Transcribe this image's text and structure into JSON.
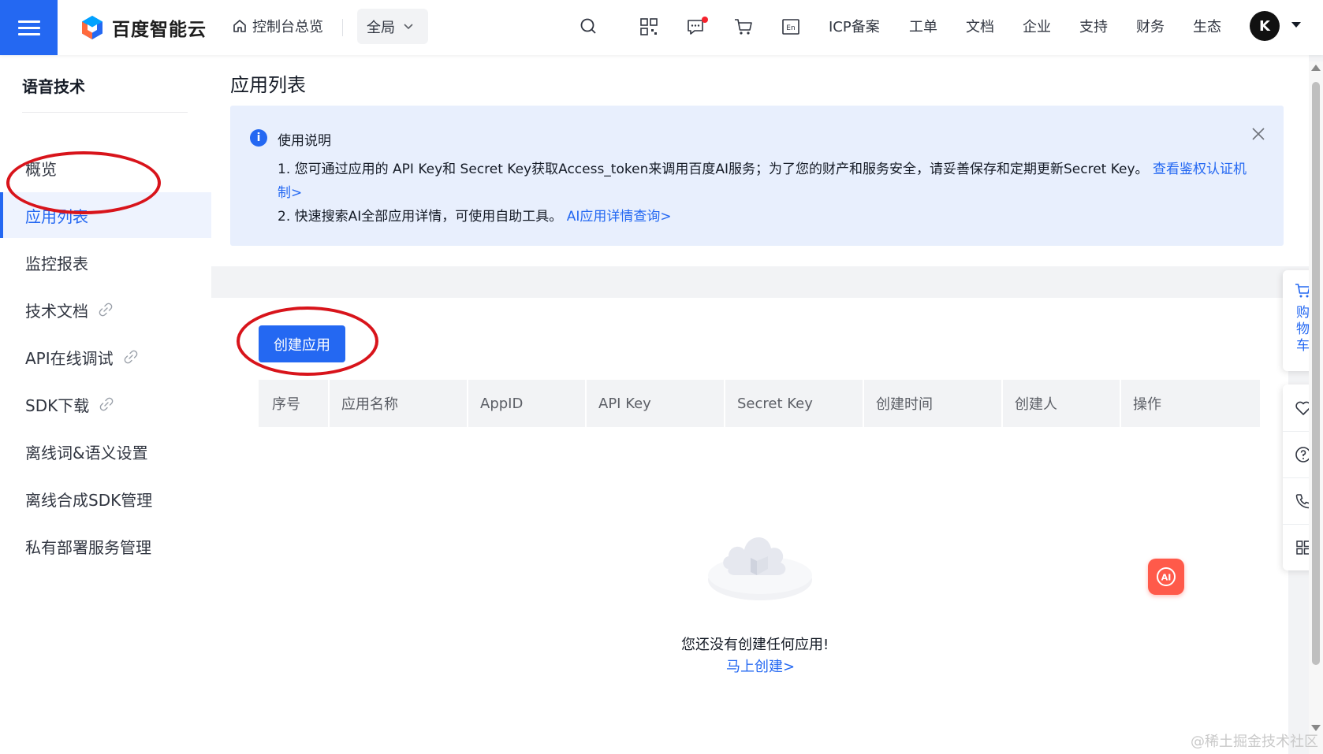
{
  "topbar": {
    "brand": "百度智能云",
    "home_label": "控制台总览",
    "region_label": "全局",
    "icons": [
      "search-icon",
      "qrcode-icon",
      "message-icon",
      "cart-icon",
      "language-icon"
    ],
    "nav": [
      "ICP备案",
      "工单",
      "文档",
      "企业",
      "支持",
      "财务",
      "生态"
    ],
    "avatar_letter": "K",
    "accent": "#2468f2"
  },
  "sidebar": {
    "title": "语音技术",
    "items": [
      {
        "label": "概览",
        "link": false
      },
      {
        "label": "应用列表",
        "link": false,
        "active": true
      },
      {
        "label": "监控报表",
        "link": false
      },
      {
        "label": "技术文档",
        "link": true
      },
      {
        "label": "API在线调试",
        "link": true
      },
      {
        "label": "SDK下载",
        "link": true
      },
      {
        "label": "离线词&语义设置",
        "link": false
      },
      {
        "label": "离线合成SDK管理",
        "link": false
      },
      {
        "label": "私有部署服务管理",
        "link": false
      }
    ]
  },
  "main": {
    "title": "应用列表",
    "notice": {
      "title": "使用说明",
      "line1": "1. 您可通过应用的 API Key和 Secret Key获取Access_token来调用百度AI服务；为了您的财产和服务安全，请妥善保存和定期更新Secret Key。",
      "line1_link": "查看鉴权认证机制>",
      "line2": "2. 快速搜索AI全部应用详情，可使用自助工具。",
      "line2_link": "AI应用详情查询>"
    },
    "create_button": "创建应用",
    "table_headers": [
      "序号",
      "应用名称",
      "AppID",
      "API Key",
      "Secret Key",
      "创建时间",
      "创建人",
      "操作"
    ],
    "empty_message": "您还没有创建任何应用!",
    "empty_link": "马上创建>"
  },
  "float": {
    "cart_label": "购物车",
    "tools": [
      "heart-icon",
      "help-icon",
      "phone-icon",
      "apps-icon"
    ],
    "ai_label": "AI"
  },
  "watermark": "@稀土掘金技术社区",
  "annotation_color": "#d8141b"
}
